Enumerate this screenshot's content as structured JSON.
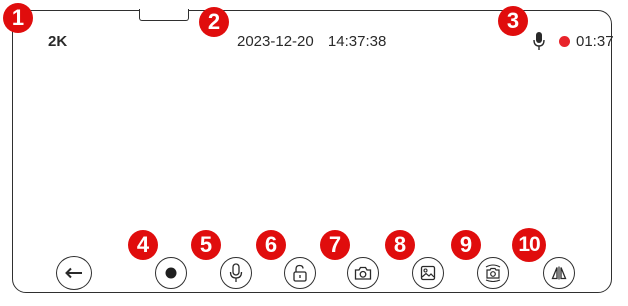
{
  "status_bar": {
    "resolution": "2K",
    "date": "2023-12-20",
    "time": "14:37:38",
    "mic_icon": "microphone-icon",
    "recording_indicator_color": "#e8242b",
    "recording_time": "01:37"
  },
  "callouts": [
    "1",
    "2",
    "3",
    "4",
    "5",
    "6",
    "7",
    "8",
    "9",
    "10"
  ],
  "controls": {
    "back": "arrow-left-icon",
    "record": "record-dot-icon",
    "microphone": "microphone-icon",
    "unlock": "unlock-icon",
    "snapshot": "camera-icon",
    "gallery": "image-icon",
    "switch_camera": "camera-switch-icon",
    "mirror": "mirror-flip-icon"
  },
  "colors": {
    "accent": "#e00d0d",
    "outline": "#2f2f2f",
    "text": "#2a2a2a"
  }
}
